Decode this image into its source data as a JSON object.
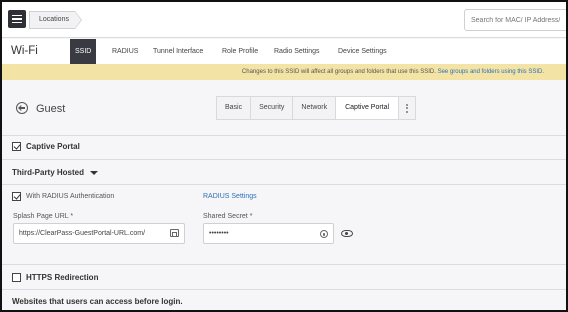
{
  "topbar": {
    "breadcrumb": "Locations",
    "search_placeholder": "Search for MAC/ IP Address/ ..."
  },
  "nav": {
    "title": "Wi-Fi",
    "tabs": [
      {
        "label": "SSID",
        "active": true
      },
      {
        "label": "RADIUS",
        "active": false
      },
      {
        "label": "Tunnel Interface",
        "active": false
      },
      {
        "label": "Role Profile",
        "active": false
      },
      {
        "label": "Radio Settings",
        "active": false
      },
      {
        "label": "Device Settings",
        "active": false
      }
    ]
  },
  "banner": {
    "text": "Changes to this SSID will affect all groups and folders that use this SSID.",
    "link": "See groups and folders using this SSID."
  },
  "header": {
    "network_name": "Guest",
    "subtabs": [
      "Basic",
      "Security",
      "Network",
      "Captive Portal"
    ],
    "active_subtab": "Captive Portal"
  },
  "captive_portal": {
    "label": "Captive Portal",
    "checked": true,
    "type_label": "Third-Party Hosted",
    "radius_auth": {
      "label": "With RADIUS Authentication",
      "checked": true
    },
    "radius_settings_link": "RADIUS Settings",
    "splash_url": {
      "label": "Splash Page URL *",
      "value": "https://ClearPass-GuestPortal-URL.com/"
    },
    "shared_secret": {
      "label": "Shared Secret *",
      "value": "••••••••"
    },
    "https_redirection": {
      "label": "HTTPS Redirection",
      "checked": false
    },
    "websites_heading": "Websites that users can access before login."
  },
  "colors": {
    "active_tab_bg": "#3a3a42",
    "banner_bg": "#f3e3a4",
    "link": "#2d6fb6"
  }
}
